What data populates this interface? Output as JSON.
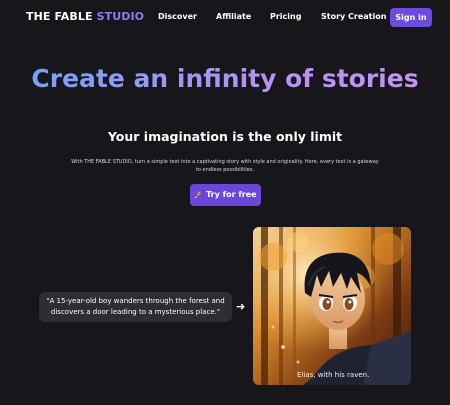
{
  "header": {
    "logo_main": "THE FABLE ",
    "logo_accent": "STUDIO",
    "nav": [
      "Discover",
      "Affiliate",
      "Pricing",
      "Story Creation"
    ],
    "signin_label": "Sign in"
  },
  "hero": {
    "title": "Create an infinity of stories",
    "subtitle": "Your imagination is the only limit",
    "description": "With THE FABLE STUDIO, turn a simple text into a captivating story with style and originality. Here, every text is a gateway to endless possibilities.",
    "cta_label": "Try for free",
    "cta_icon": "rocket-icon"
  },
  "example": {
    "prompt": "\"A 15-year-old boy wanders through the forest and discovers a door leading to a mysterious place.\"",
    "arrow": "➜",
    "caption": "Elias, with his raven."
  },
  "colors": {
    "background": "#17171b",
    "accent": "#6c4be0",
    "logo_accent": "#8f7cf2",
    "title_gradient_start": "#6ea3ff",
    "title_gradient_end": "#c694f3",
    "prompt_bubble": "#2d2d33"
  }
}
